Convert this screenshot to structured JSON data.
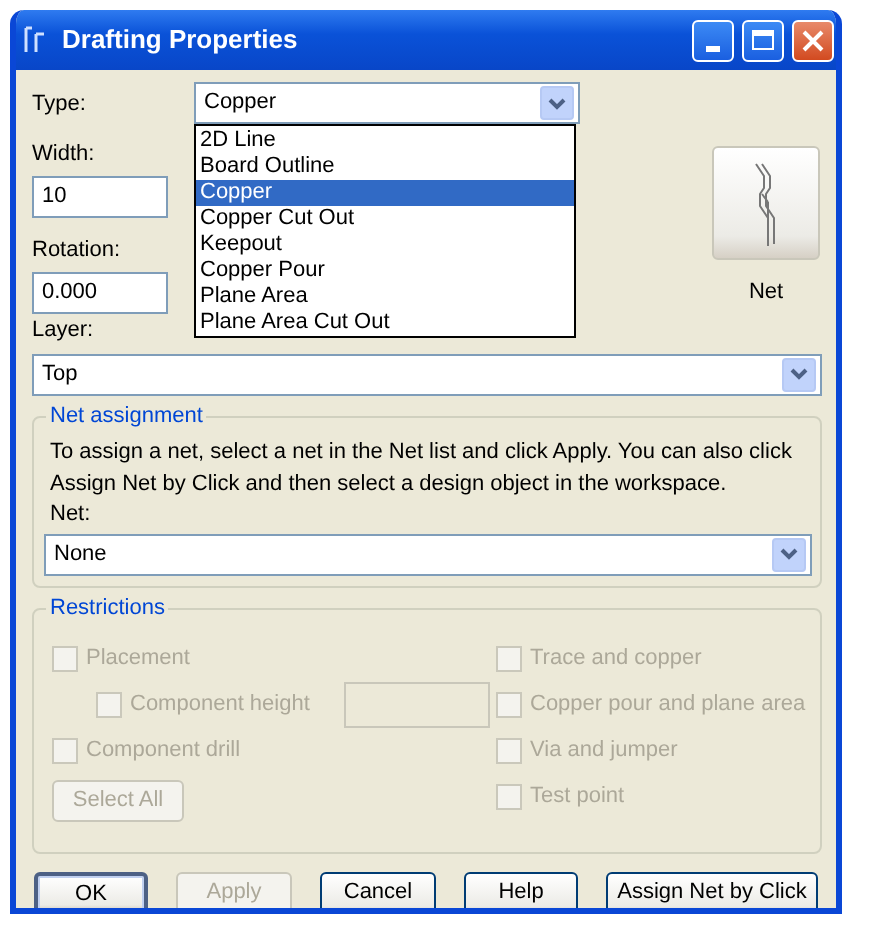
{
  "window": {
    "title": "Drafting Properties"
  },
  "type_field": {
    "label": "Type:",
    "value": "Copper",
    "expanded": true,
    "options": [
      {
        "label": "2D Line",
        "selected": false
      },
      {
        "label": "Board Outline",
        "selected": false
      },
      {
        "label": "Copper",
        "selected": true
      },
      {
        "label": "Copper Cut Out",
        "selected": false
      },
      {
        "label": "Keepout",
        "selected": false
      },
      {
        "label": "Copper Pour",
        "selected": false
      },
      {
        "label": "Plane Area",
        "selected": false
      },
      {
        "label": "Plane Area Cut Out",
        "selected": false
      }
    ]
  },
  "width_field": {
    "label": "Width:",
    "value": "10"
  },
  "rotation_field": {
    "label": "Rotation:",
    "value": "0.000"
  },
  "net_button": {
    "label": "Net"
  },
  "layer_field": {
    "label": "Layer:",
    "value": "Top"
  },
  "net_assignment": {
    "title": "Net assignment",
    "description": "To assign a net, select a net in the Net list and click Apply. You can also click Assign Net by Click and then select a design object in the workspace.",
    "net_label": "Net:",
    "net_value": "None"
  },
  "restrictions": {
    "title": "Restrictions",
    "left_items": [
      {
        "kind": "checkbox",
        "label": "Placement",
        "checked": false,
        "disabled": true
      },
      {
        "kind": "indented-checkbox",
        "label": "Component height",
        "checked": false,
        "disabled": true
      },
      {
        "kind": "checkbox",
        "label": "Component drill",
        "checked": false,
        "disabled": true
      },
      {
        "kind": "button",
        "label": "Select All",
        "disabled": true
      }
    ],
    "right_items": [
      {
        "kind": "checkbox",
        "label": "Trace and copper",
        "checked": false,
        "disabled": true
      },
      {
        "kind": "checkbox",
        "label": "Copper pour and plane area",
        "checked": false,
        "disabled": true
      },
      {
        "kind": "checkbox",
        "label": "Via and jumper",
        "checked": false,
        "disabled": true
      },
      {
        "kind": "checkbox",
        "label": "Test point",
        "checked": false,
        "disabled": true
      }
    ]
  },
  "buttons": [
    {
      "label": "OK",
      "disabled": false,
      "default": true
    },
    {
      "label": "Apply",
      "disabled": true,
      "default": false
    },
    {
      "label": "Cancel",
      "disabled": false,
      "default": false
    },
    {
      "label": "Help",
      "disabled": false,
      "default": false
    },
    {
      "label": "Assign Net by Click",
      "disabled": false,
      "default": false
    }
  ]
}
